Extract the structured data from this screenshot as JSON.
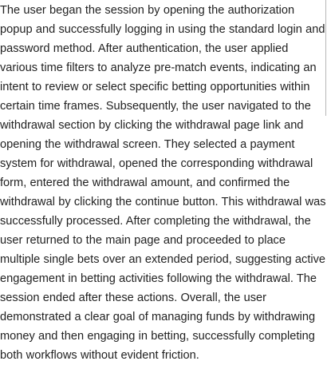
{
  "document": {
    "paragraph": "The user began the session by opening the authorization popup and successfully logging in using the standard login and password method. After authentication, the user applied various time filters to analyze pre-match events, indicating an intent to review or select specific betting opportunities within certain time frames. Subsequently, the user navigated to the withdrawal section by clicking the withdrawal page link and opening the withdrawal screen. They selected a payment system for withdrawal, opened the corresponding withdrawal form, entered the withdrawal amount, and confirmed the withdrawal by clicking the continue button. This withdrawal was successfully processed. After completing the withdrawal, the user returned to the main page and proceeded to place multiple single bets over an extended period, suggesting active engagement in betting activities following the withdrawal. The session ended after these actions. Overall, the user demonstrated a clear goal of managing funds by withdrawing money and then engaging in betting, successfully completing both workflows without evident friction."
  }
}
